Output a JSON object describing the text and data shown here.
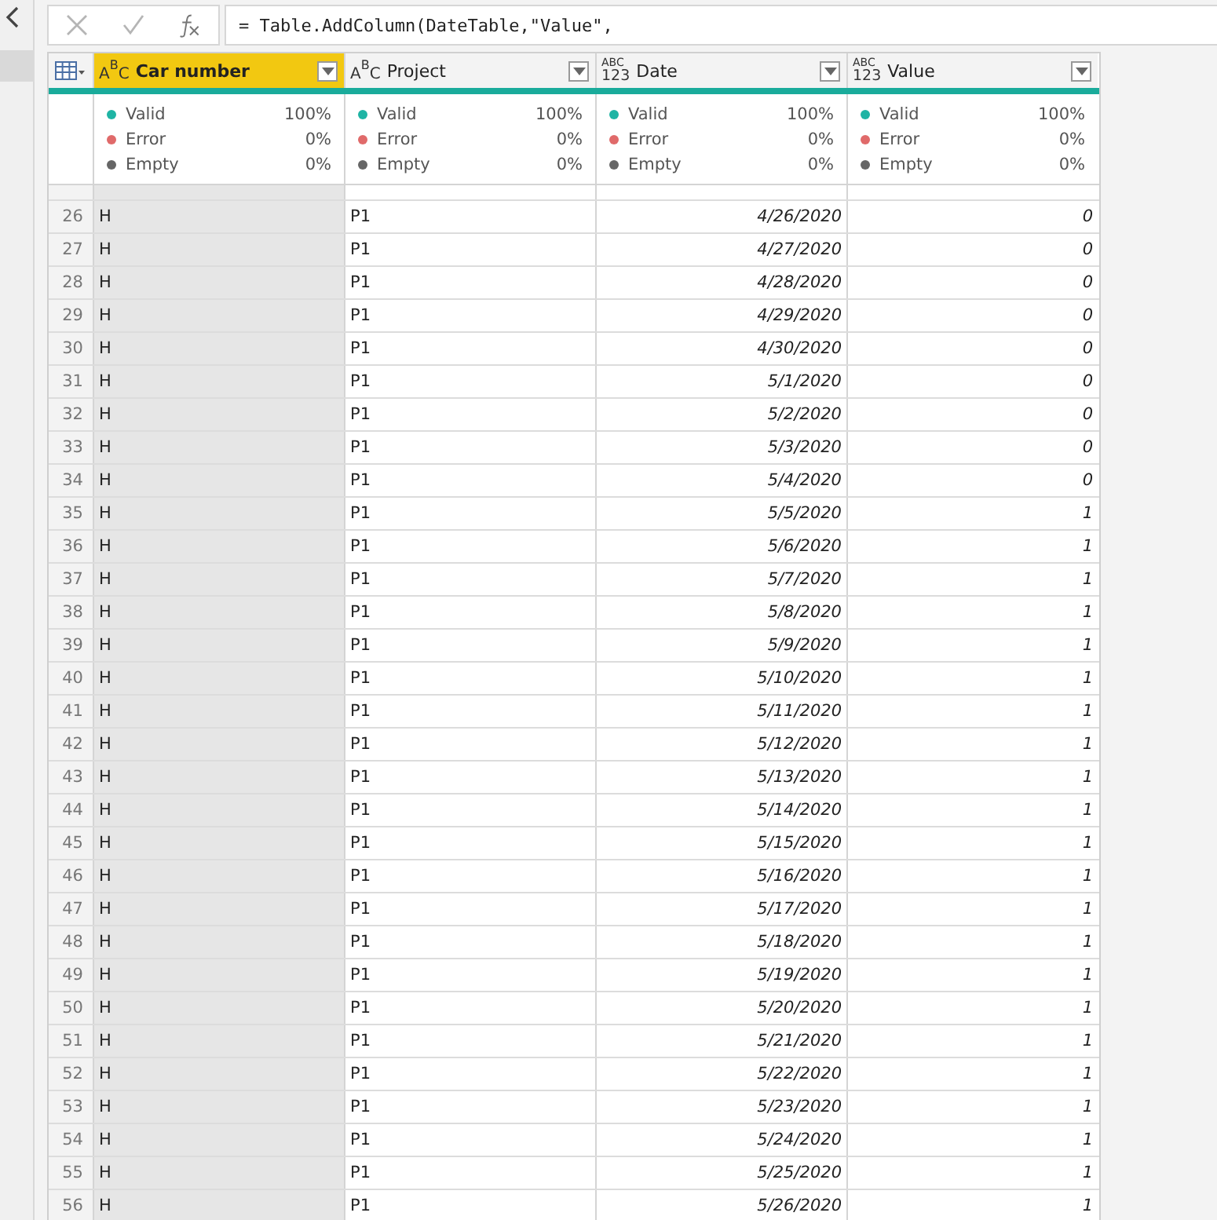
{
  "formula_bar": {
    "formula": "= Table.AddColumn(DateTable,\"Value\","
  },
  "columns": [
    {
      "kind": "text",
      "type_icon": [
        "A",
        "B",
        "C"
      ],
      "name": "Car number",
      "selected": true,
      "quality": [
        {
          "label": "Valid",
          "value": "100%"
        },
        {
          "label": "Error",
          "value": "0%"
        },
        {
          "label": "Empty",
          "value": "0%"
        }
      ]
    },
    {
      "kind": "text",
      "type_icon": [
        "A",
        "B",
        "C"
      ],
      "name": "Project",
      "selected": false,
      "quality": [
        {
          "label": "Valid",
          "value": "100%"
        },
        {
          "label": "Error",
          "value": "0%"
        },
        {
          "label": "Empty",
          "value": "0%"
        }
      ]
    },
    {
      "kind": "any",
      "type_icon": [
        "ABC",
        "123"
      ],
      "name": "Date",
      "selected": false,
      "quality": [
        {
          "label": "Valid",
          "value": "100%"
        },
        {
          "label": "Error",
          "value": "0%"
        },
        {
          "label": "Empty",
          "value": "0%"
        }
      ]
    },
    {
      "kind": "any",
      "type_icon": [
        "ABC",
        "123"
      ],
      "name": "Value",
      "selected": false,
      "quality": [
        {
          "label": "Valid",
          "value": "100%"
        },
        {
          "label": "Error",
          "value": "0%"
        },
        {
          "label": "Empty",
          "value": "0%"
        }
      ]
    }
  ],
  "rows": [
    [
      "26",
      "H",
      "P1",
      "4/26/2020",
      "0"
    ],
    [
      "27",
      "H",
      "P1",
      "4/27/2020",
      "0"
    ],
    [
      "28",
      "H",
      "P1",
      "4/28/2020",
      "0"
    ],
    [
      "29",
      "H",
      "P1",
      "4/29/2020",
      "0"
    ],
    [
      "30",
      "H",
      "P1",
      "4/30/2020",
      "0"
    ],
    [
      "31",
      "H",
      "P1",
      "5/1/2020",
      "0"
    ],
    [
      "32",
      "H",
      "P1",
      "5/2/2020",
      "0"
    ],
    [
      "33",
      "H",
      "P1",
      "5/3/2020",
      "0"
    ],
    [
      "34",
      "H",
      "P1",
      "5/4/2020",
      "0"
    ],
    [
      "35",
      "H",
      "P1",
      "5/5/2020",
      "1"
    ],
    [
      "36",
      "H",
      "P1",
      "5/6/2020",
      "1"
    ],
    [
      "37",
      "H",
      "P1",
      "5/7/2020",
      "1"
    ],
    [
      "38",
      "H",
      "P1",
      "5/8/2020",
      "1"
    ],
    [
      "39",
      "H",
      "P1",
      "5/9/2020",
      "1"
    ],
    [
      "40",
      "H",
      "P1",
      "5/10/2020",
      "1"
    ],
    [
      "41",
      "H",
      "P1",
      "5/11/2020",
      "1"
    ],
    [
      "42",
      "H",
      "P1",
      "5/12/2020",
      "1"
    ],
    [
      "43",
      "H",
      "P1",
      "5/13/2020",
      "1"
    ],
    [
      "44",
      "H",
      "P1",
      "5/14/2020",
      "1"
    ],
    [
      "45",
      "H",
      "P1",
      "5/15/2020",
      "1"
    ],
    [
      "46",
      "H",
      "P1",
      "5/16/2020",
      "1"
    ],
    [
      "47",
      "H",
      "P1",
      "5/17/2020",
      "1"
    ],
    [
      "48",
      "H",
      "P1",
      "5/18/2020",
      "1"
    ],
    [
      "49",
      "H",
      "P1",
      "5/19/2020",
      "1"
    ],
    [
      "50",
      "H",
      "P1",
      "5/20/2020",
      "1"
    ],
    [
      "51",
      "H",
      "P1",
      "5/21/2020",
      "1"
    ],
    [
      "52",
      "H",
      "P1",
      "5/22/2020",
      "1"
    ],
    [
      "53",
      "H",
      "P1",
      "5/23/2020",
      "1"
    ],
    [
      "54",
      "H",
      "P1",
      "5/24/2020",
      "1"
    ],
    [
      "55",
      "H",
      "P1",
      "5/25/2020",
      "1"
    ],
    [
      "56",
      "H",
      "P1",
      "5/26/2020",
      "1"
    ]
  ]
}
